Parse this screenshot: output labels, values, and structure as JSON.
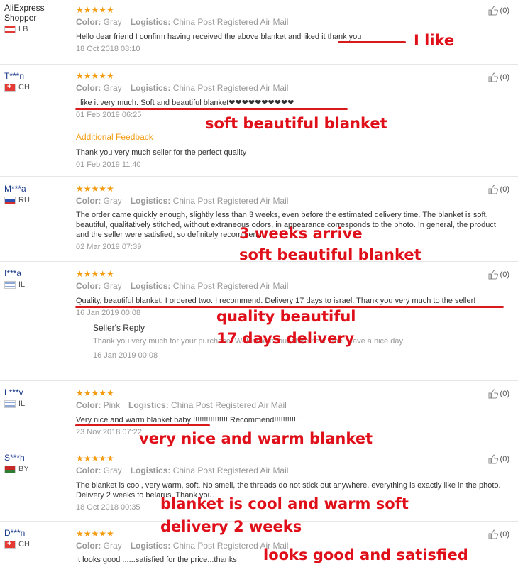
{
  "reviews": [
    {
      "user": "AliExpress Shopper",
      "country": "LB",
      "flag": "lb",
      "color_label": "Color:",
      "color": "Gray",
      "logistics_label": "Logistics:",
      "logistics": "China Post Registered Air Mail",
      "text": "Hello dear friend I confirm having received the above blanket and liked it thank you",
      "date": "18 Oct 2018 08:10",
      "helpful": "(0)"
    },
    {
      "user": "T***n",
      "country": "CH",
      "flag": "ch",
      "color_label": "Color:",
      "color": "Gray",
      "logistics_label": "Logistics:",
      "logistics": "China Post Registered Air Mail",
      "text": "I like it very much. Soft and beautiful blanket❤❤❤❤❤❤❤❤❤❤",
      "date": "01 Feb 2019 06:25",
      "helpful": "(0)",
      "additional_label": "Additional Feedback",
      "additional_text": "Thank you very much seller for the perfect quality",
      "additional_date": "01 Feb 2019 11:40"
    },
    {
      "user": "M***a",
      "country": "RU",
      "flag": "ru",
      "color_label": "Color:",
      "color": "Gray",
      "logistics_label": "Logistics:",
      "logistics": "China Post Registered Air Mail",
      "text": "The order came quickly enough, slightly less than 3 weeks, even before the estimated delivery time. The blanket is soft, beautiful, qualitatively stitched, without extraneous odors, in appearance corresponds to the photo. In general, the product and the seller were satisfied, so definitely recommend!",
      "date": "02 Mar 2019 07:39",
      "helpful": "(0)"
    },
    {
      "user": "I***a",
      "country": "IL",
      "flag": "il",
      "color_label": "Color:",
      "color": "Gray",
      "logistics_label": "Logistics:",
      "logistics": "China Post Registered Air Mail",
      "text": "Quality, beautiful blanket. I ordered two. I recommend. Delivery 17 days to israel. Thank you very much to the seller!",
      "date": "16 Jan 2019 00:08",
      "helpful": "(0)",
      "seller_label": "Seller's Reply",
      "seller_text": "Thank you very much for your purchase. Welcome to our store next time. Have a nice day!",
      "seller_date": "16 Jan 2019 00:08"
    },
    {
      "user": "L***v",
      "country": "IL",
      "flag": "il",
      "color_label": "Color:",
      "color": "Pink",
      "logistics_label": "Logistics:",
      "logistics": "China Post Registered Air Mail",
      "text": "Very nice and warm blanket baby!!!!!!!!!!!!!!!!! Recommend!!!!!!!!!!!!",
      "date": "23 Nov 2018 07:22",
      "helpful": "(0)"
    },
    {
      "user": "S***h",
      "country": "BY",
      "flag": "by",
      "color_label": "Color:",
      "color": "Gray",
      "logistics_label": "Logistics:",
      "logistics": "China Post Registered Air Mail",
      "text": "The blanket is cool, very warm, soft. No smell, the threads do not stick out anywhere, everything is exactly like in the photo. Delivery 2 weeks to belarus. Thank you.",
      "date": "18 Oct 2018 00:35",
      "helpful": "(0)"
    },
    {
      "user": "D***n",
      "country": "CH",
      "flag": "ch",
      "color_label": "Color:",
      "color": "Gray",
      "logistics_label": "Logistics:",
      "logistics": "China Post Registered Air Mail",
      "text": "It looks good ......satisfied for the price...thanks",
      "date": "",
      "helpful": "(0)"
    }
  ],
  "stars": "★★★★★",
  "annotations": {
    "a1": "I like",
    "a2": "soft beautiful blanket",
    "a3a": "3 weeks arrive",
    "a3b": "soft beautiful blanket",
    "a4a": "quality beautiful",
    "a4b": "17 days delivery",
    "a5": "very nice and warm blanket",
    "a6a": "blanket is cool and warm soft",
    "a6b": "delivery 2 weeks",
    "a7": "looks good and satisfied"
  },
  "colors": {
    "annotation": "#e0101a",
    "stars": "#f39c12",
    "username": "#1a3a8a"
  }
}
